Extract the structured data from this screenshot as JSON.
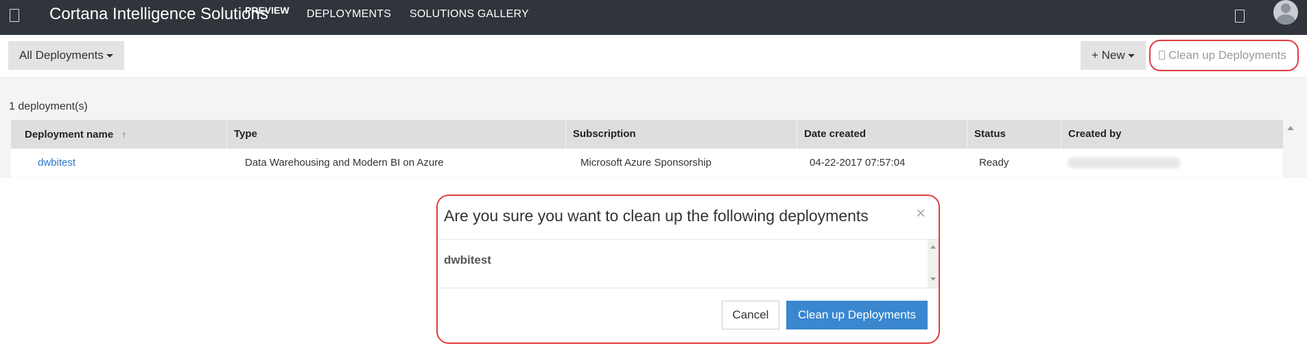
{
  "topbar": {
    "app_title": "Cortana Intelligence Solutions",
    "preview_badge": "PREVIEW",
    "nav_deployments": "DEPLOYMENTS",
    "nav_gallery": "SOLUTIONS GALLERY"
  },
  "toolbar": {
    "filter_label": "All Deployments",
    "new_label": "+ New",
    "cleanup_label": "Clean up Deployments"
  },
  "list": {
    "count_label": "1 deployment(s)",
    "columns": [
      "Deployment name",
      "Type",
      "Subscription",
      "Date created",
      "Status",
      "Created by"
    ],
    "sort_indicator": "↑",
    "rows": [
      {
        "name": "dwbitest",
        "type": "Data Warehousing and Modern BI on Azure",
        "subscription": "Microsoft Azure Sponsorship",
        "date_created": "04-22-2017 07:57:04",
        "status": "Ready"
      }
    ]
  },
  "modal": {
    "title": "Are you sure you want to clean up the following deployments",
    "close_glyph": "×",
    "items": [
      "dwbitest"
    ],
    "cancel_label": "Cancel",
    "confirm_label": "Clean up Deployments"
  },
  "colors": {
    "topbar_bg": "#2f353b",
    "link": "#2a78c6",
    "primary_button": "#3a87cf",
    "highlight_border": "#e23a3f"
  }
}
